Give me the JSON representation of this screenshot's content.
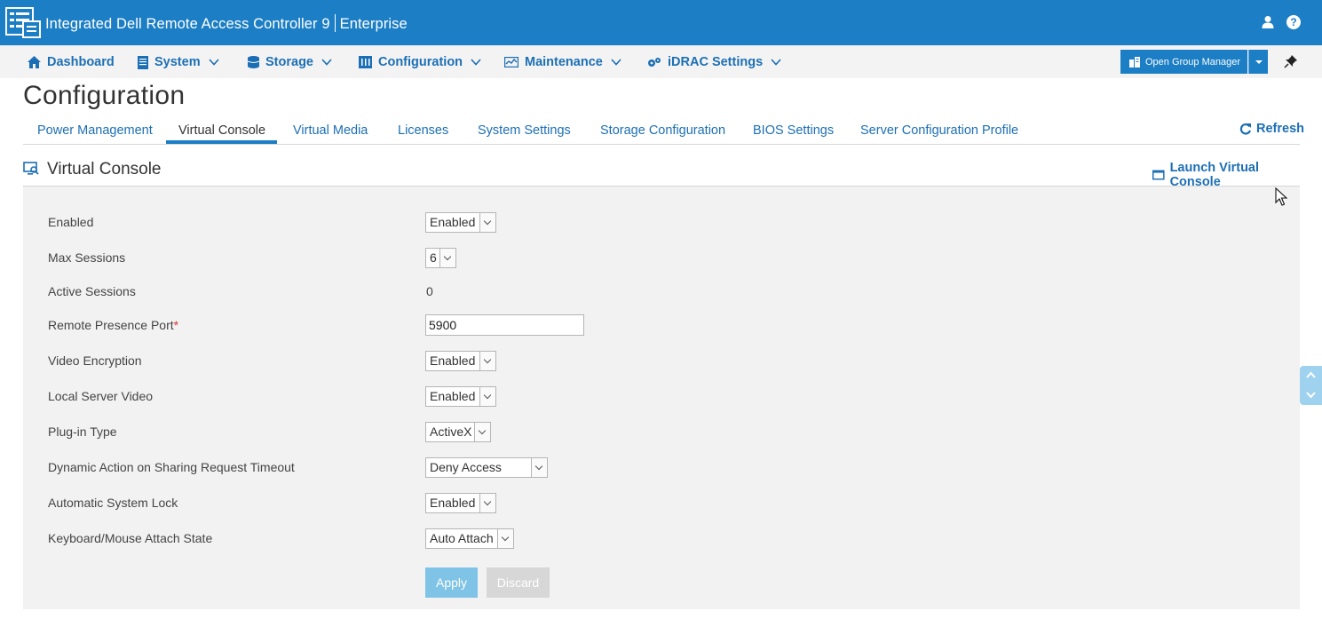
{
  "app": {
    "title": "Integrated Dell Remote Access Controller 9",
    "edition": "Enterprise",
    "icons": [
      "idrac-logo-icon",
      "user-icon",
      "help-icon"
    ],
    "help_glyph": "?"
  },
  "nav": {
    "items": [
      {
        "label": "Dashboard",
        "icon": "home-icon",
        "has_menu": false
      },
      {
        "label": "System",
        "icon": "server-icon",
        "has_menu": true
      },
      {
        "label": "Storage",
        "icon": "storage-icon",
        "has_menu": true
      },
      {
        "label": "Configuration",
        "icon": "configuration-icon",
        "has_menu": true
      },
      {
        "label": "Maintenance",
        "icon": "maintenance-icon",
        "has_menu": true
      },
      {
        "label": "iDRAC Settings",
        "icon": "gears-icon",
        "has_menu": true
      }
    ],
    "group_manager": "Open Group Manager"
  },
  "page": {
    "title": "Configuration",
    "tabs": [
      {
        "label": "Power Management",
        "active": false
      },
      {
        "label": "Virtual Console",
        "active": true
      },
      {
        "label": "Virtual Media",
        "active": false
      },
      {
        "label": "Licenses",
        "active": false
      },
      {
        "label": "System Settings",
        "active": false
      },
      {
        "label": "Storage Configuration",
        "active": false
      },
      {
        "label": "BIOS Settings",
        "active": false
      },
      {
        "label": "Server Configuration Profile",
        "active": false
      }
    ],
    "refresh": "Refresh"
  },
  "section": {
    "title": "Virtual Console",
    "launch": "Launch Virtual Console"
  },
  "form": {
    "enabled": {
      "label": "Enabled",
      "value": "Enabled"
    },
    "max_sessions": {
      "label": "Max Sessions",
      "value": "6"
    },
    "active_sessions": {
      "label": "Active Sessions",
      "value": "0"
    },
    "remote_port": {
      "label": "Remote Presence Port",
      "required": "*",
      "value": "5900"
    },
    "video_encryption": {
      "label": "Video Encryption",
      "value": "Enabled"
    },
    "local_video": {
      "label": "Local Server Video",
      "value": "Enabled"
    },
    "plugin_type": {
      "label": "Plug-in Type",
      "value": "ActiveX"
    },
    "dynamic_action": {
      "label": "Dynamic Action on Sharing Request Timeout",
      "value": "Deny Access"
    },
    "auto_lock": {
      "label": "Automatic System Lock",
      "value": "Enabled"
    },
    "kbd_mouse": {
      "label": "Keyboard/Mouse Attach State",
      "value": "Auto Attach"
    },
    "apply": "Apply",
    "discard": "Discard"
  },
  "colors": {
    "header_blue": "#1c7ec4",
    "link_blue": "#1c6fb5",
    "panel_gray": "#f2f2f2",
    "apply_disabled": "#7fc4e6",
    "discard_disabled": "#d7d7d7",
    "required_red": "#d9322c"
  }
}
